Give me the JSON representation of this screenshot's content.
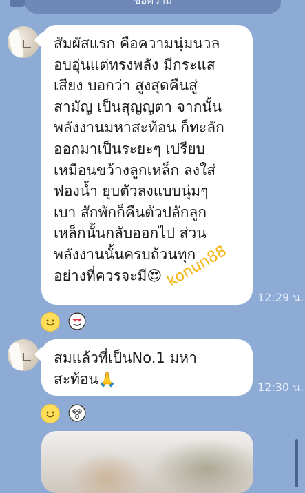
{
  "header": {
    "title": "ข้อความ"
  },
  "messages": [
    {
      "lines": [
        "สัมผัสแรก คือความนุ่มนวล",
        "อบอุ่นแต่ทรงพลัง มีกระแส",
        "เสียง บอกว่า สูงสุดคืนสู่",
        "สามัญ เป็นสุญญตา  จากนั้น",
        "พลังงานมหาสะท้อน ก็ทะลัก",
        "ออกมาเป็นระยะๆ เปรียบ",
        "เหมือนขว้างลูกเหล็ก ลงใส่",
        "ฟองน้ำ ยุบตัวลงแบบนุ่มๆ",
        "เบา สักพักก็คืนตัวปลักลูก",
        "เหล็กนั้นกลับออกไป ส่วน",
        "พลังงานนั้นครบถ้วนทุก",
        "อย่างที่ควรจะมี"
      ],
      "end_emoji": "😍",
      "time": "12:29 น.",
      "reactions": [
        "smile-icon",
        "heart-eyes-icon"
      ]
    },
    {
      "lines": [
        "สมแล้วที่เป็นNo.1 มหา",
        "สะท้อน"
      ],
      "end_emoji": "🙏",
      "time": "12:30 น.",
      "reactions": [
        "smile-icon",
        "wow-icon"
      ]
    }
  ],
  "watermark": "konun88",
  "colors": {
    "background": "#8eabd6",
    "bubble": "#ffffff",
    "watermark": "#f4b400"
  }
}
